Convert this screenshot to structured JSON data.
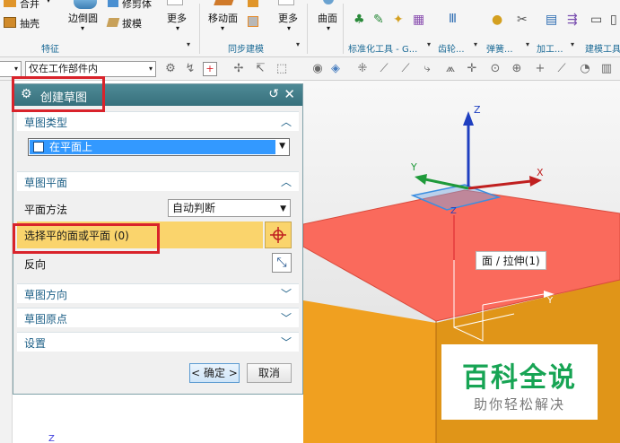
{
  "ribbon": {
    "merge_label": "合并",
    "extract_label": "抽壳",
    "edge_blend_label": "边倒圆",
    "trim_body_label": "修剪体",
    "draft_label": "拔模",
    "more_label": "更多",
    "move_face_label": "移动面",
    "more2_label": "更多",
    "surface_label": "曲面",
    "feature_group": "特征",
    "sync_group": "同步建模",
    "standard_tools_group": "标准化工具 - G...",
    "gear_group": "齿轮...",
    "spring_group": "弹簧...",
    "machining_group": "加工...",
    "build_tools_group": "建模工具"
  },
  "toolbar": {
    "filter_value": "仅在工作部件内"
  },
  "dialog": {
    "title": "创建草图",
    "sketch_type": {
      "header": "草图类型",
      "value": "在平面上"
    },
    "sketch_plane": {
      "header": "草图平面",
      "plane_method_label": "平面方法",
      "plane_method_value": "自动判断",
      "select_label": "选择平的面或平面 (0)",
      "reverse_label": "反向"
    },
    "sketch_direction": {
      "header": "草图方向"
    },
    "sketch_origin": {
      "header": "草图原点"
    },
    "settings": {
      "header": "设置"
    },
    "ok_label": "< 确定 >",
    "cancel_label": "取消"
  },
  "viewport": {
    "face_tag": "面 / 拉伸(1)",
    "axis_z": "Z",
    "axis_x": "X",
    "axis_y": "Y",
    "bottom_axis": "Z"
  },
  "watermark": {
    "title": "百科全说",
    "subtitle": "助你轻松解决"
  },
  "colors": {
    "dialog_title_bg": "#3f7d88",
    "selected_row": "#fad46c",
    "highlight_box": "#d9232b",
    "block_top": "#fa6a5c",
    "block_side": "#f0a020",
    "watermark_green": "#17a454"
  }
}
